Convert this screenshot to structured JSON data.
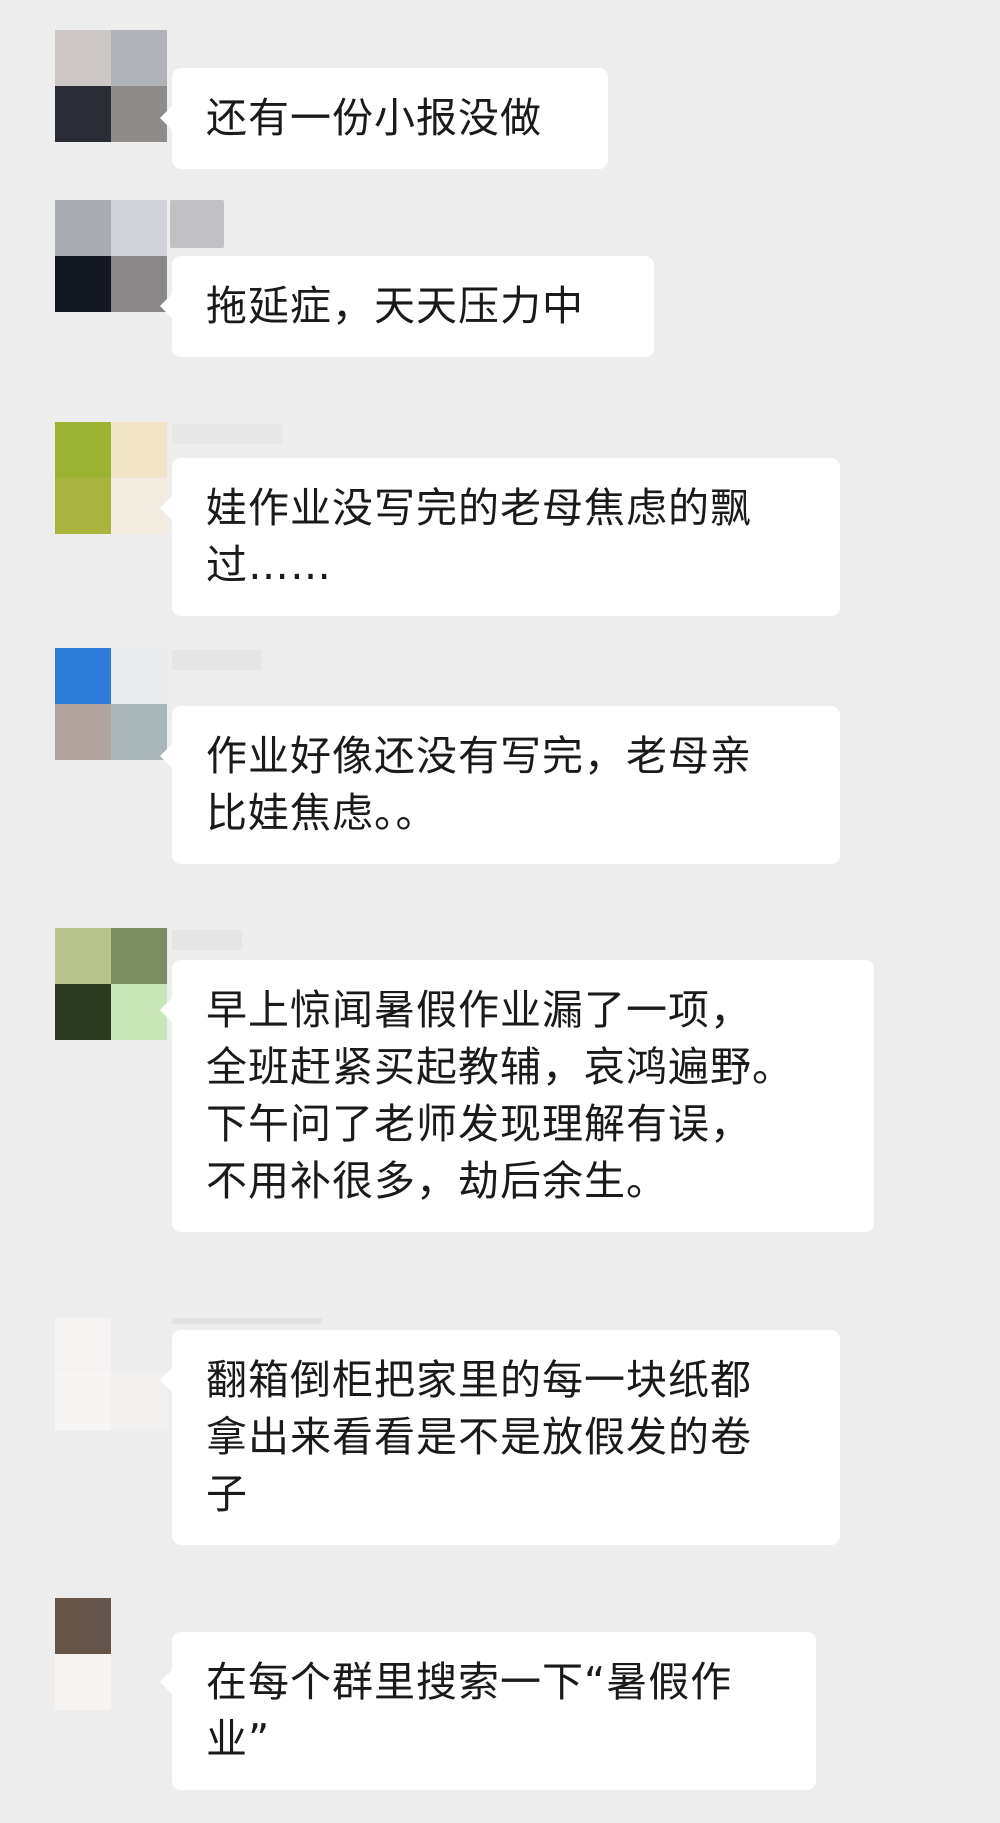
{
  "messages": [
    {
      "lines": [
        "还有一份小报没做"
      ],
      "avatar_colors": [
        "#cdc8c6",
        "#b0b3b8",
        "#2a2d36",
        "#8e8b88"
      ]
    },
    {
      "lines": [
        "拖延症，天天压力中"
      ],
      "avatar_colors": [
        "#a9acb3",
        "#cfd2d8",
        "#141820",
        "#8a8788"
      ]
    },
    {
      "lines": [
        "娃作业没写完的老母焦虑的飘",
        "过……"
      ],
      "avatar_colors": [
        "#9bb233",
        "#f1e4c8",
        "#a8b43e",
        "#f2ece0"
      ]
    },
    {
      "lines": [
        "作业好像还没有写完，老母亲",
        "比娃焦虑。。"
      ],
      "avatar_colors": [
        "#2e7ad8",
        "#e8eaec",
        "#b0a39e",
        "#a9b6b9"
      ]
    },
    {
      "lines": [
        "早上惊闻暑假作业漏了一项，",
        "全班赶紧买起教辅，哀鸿遍野。",
        "下午问了老师发现理解有误，",
        "不用补很多，劫后余生。"
      ],
      "avatar_colors": [
        "#b8c48a",
        "#7b8e63",
        "#2d3a22",
        "#c9e6b8"
      ]
    },
    {
      "lines": [
        "翻箱倒柜把家里的每一块纸都",
        "拿出来看看是不是放假发的卷",
        "子"
      ],
      "avatar_colors": [
        "#f4f3f1",
        "#ededed",
        "#f6f5f3",
        "#f1f0ee"
      ]
    },
    {
      "lines": [
        "在每个群里搜索一下“暑假作",
        "业”"
      ],
      "avatar_colors": [
        "#655448",
        "#ededed",
        "#f6f3f0",
        "#ededed"
      ]
    }
  ]
}
